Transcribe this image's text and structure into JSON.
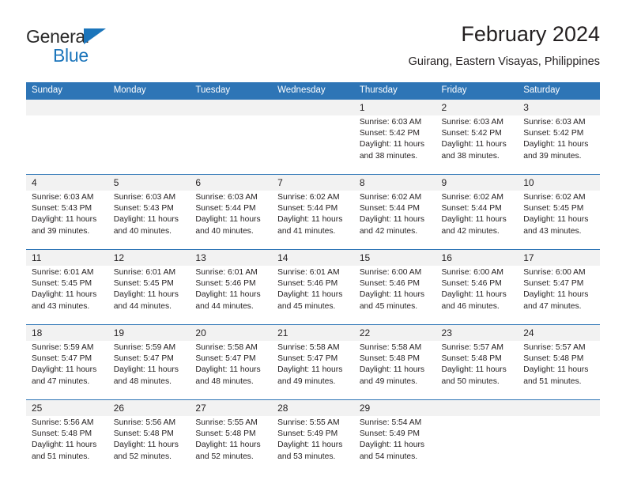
{
  "brand": {
    "name_part1": "General",
    "name_part2": "Blue",
    "accent_color": "#1b75bb"
  },
  "header": {
    "title": "February 2024",
    "subtitle": "Guirang, Eastern Visayas, Philippines"
  },
  "theme": {
    "header_blue": "#2e75b6",
    "daynum_background": "#f2f2f2",
    "text_color": "#231f20"
  },
  "calendar": {
    "weekday_headers": [
      "Sunday",
      "Monday",
      "Tuesday",
      "Wednesday",
      "Thursday",
      "Friday",
      "Saturday"
    ],
    "weeks": [
      [
        {
          "day": "",
          "sunrise": "",
          "sunset": "",
          "daylight": ""
        },
        {
          "day": "",
          "sunrise": "",
          "sunset": "",
          "daylight": ""
        },
        {
          "day": "",
          "sunrise": "",
          "sunset": "",
          "daylight": ""
        },
        {
          "day": "",
          "sunrise": "",
          "sunset": "",
          "daylight": ""
        },
        {
          "day": "1",
          "sunrise": "Sunrise: 6:03 AM",
          "sunset": "Sunset: 5:42 PM",
          "daylight": "Daylight: 11 hours and 38 minutes."
        },
        {
          "day": "2",
          "sunrise": "Sunrise: 6:03 AM",
          "sunset": "Sunset: 5:42 PM",
          "daylight": "Daylight: 11 hours and 38 minutes."
        },
        {
          "day": "3",
          "sunrise": "Sunrise: 6:03 AM",
          "sunset": "Sunset: 5:42 PM",
          "daylight": "Daylight: 11 hours and 39 minutes."
        }
      ],
      [
        {
          "day": "4",
          "sunrise": "Sunrise: 6:03 AM",
          "sunset": "Sunset: 5:43 PM",
          "daylight": "Daylight: 11 hours and 39 minutes."
        },
        {
          "day": "5",
          "sunrise": "Sunrise: 6:03 AM",
          "sunset": "Sunset: 5:43 PM",
          "daylight": "Daylight: 11 hours and 40 minutes."
        },
        {
          "day": "6",
          "sunrise": "Sunrise: 6:03 AM",
          "sunset": "Sunset: 5:44 PM",
          "daylight": "Daylight: 11 hours and 40 minutes."
        },
        {
          "day": "7",
          "sunrise": "Sunrise: 6:02 AM",
          "sunset": "Sunset: 5:44 PM",
          "daylight": "Daylight: 11 hours and 41 minutes."
        },
        {
          "day": "8",
          "sunrise": "Sunrise: 6:02 AM",
          "sunset": "Sunset: 5:44 PM",
          "daylight": "Daylight: 11 hours and 42 minutes."
        },
        {
          "day": "9",
          "sunrise": "Sunrise: 6:02 AM",
          "sunset": "Sunset: 5:44 PM",
          "daylight": "Daylight: 11 hours and 42 minutes."
        },
        {
          "day": "10",
          "sunrise": "Sunrise: 6:02 AM",
          "sunset": "Sunset: 5:45 PM",
          "daylight": "Daylight: 11 hours and 43 minutes."
        }
      ],
      [
        {
          "day": "11",
          "sunrise": "Sunrise: 6:01 AM",
          "sunset": "Sunset: 5:45 PM",
          "daylight": "Daylight: 11 hours and 43 minutes."
        },
        {
          "day": "12",
          "sunrise": "Sunrise: 6:01 AM",
          "sunset": "Sunset: 5:45 PM",
          "daylight": "Daylight: 11 hours and 44 minutes."
        },
        {
          "day": "13",
          "sunrise": "Sunrise: 6:01 AM",
          "sunset": "Sunset: 5:46 PM",
          "daylight": "Daylight: 11 hours and 44 minutes."
        },
        {
          "day": "14",
          "sunrise": "Sunrise: 6:01 AM",
          "sunset": "Sunset: 5:46 PM",
          "daylight": "Daylight: 11 hours and 45 minutes."
        },
        {
          "day": "15",
          "sunrise": "Sunrise: 6:00 AM",
          "sunset": "Sunset: 5:46 PM",
          "daylight": "Daylight: 11 hours and 45 minutes."
        },
        {
          "day": "16",
          "sunrise": "Sunrise: 6:00 AM",
          "sunset": "Sunset: 5:46 PM",
          "daylight": "Daylight: 11 hours and 46 minutes."
        },
        {
          "day": "17",
          "sunrise": "Sunrise: 6:00 AM",
          "sunset": "Sunset: 5:47 PM",
          "daylight": "Daylight: 11 hours and 47 minutes."
        }
      ],
      [
        {
          "day": "18",
          "sunrise": "Sunrise: 5:59 AM",
          "sunset": "Sunset: 5:47 PM",
          "daylight": "Daylight: 11 hours and 47 minutes."
        },
        {
          "day": "19",
          "sunrise": "Sunrise: 5:59 AM",
          "sunset": "Sunset: 5:47 PM",
          "daylight": "Daylight: 11 hours and 48 minutes."
        },
        {
          "day": "20",
          "sunrise": "Sunrise: 5:58 AM",
          "sunset": "Sunset: 5:47 PM",
          "daylight": "Daylight: 11 hours and 48 minutes."
        },
        {
          "day": "21",
          "sunrise": "Sunrise: 5:58 AM",
          "sunset": "Sunset: 5:47 PM",
          "daylight": "Daylight: 11 hours and 49 minutes."
        },
        {
          "day": "22",
          "sunrise": "Sunrise: 5:58 AM",
          "sunset": "Sunset: 5:48 PM",
          "daylight": "Daylight: 11 hours and 49 minutes."
        },
        {
          "day": "23",
          "sunrise": "Sunrise: 5:57 AM",
          "sunset": "Sunset: 5:48 PM",
          "daylight": "Daylight: 11 hours and 50 minutes."
        },
        {
          "day": "24",
          "sunrise": "Sunrise: 5:57 AM",
          "sunset": "Sunset: 5:48 PM",
          "daylight": "Daylight: 11 hours and 51 minutes."
        }
      ],
      [
        {
          "day": "25",
          "sunrise": "Sunrise: 5:56 AM",
          "sunset": "Sunset: 5:48 PM",
          "daylight": "Daylight: 11 hours and 51 minutes."
        },
        {
          "day": "26",
          "sunrise": "Sunrise: 5:56 AM",
          "sunset": "Sunset: 5:48 PM",
          "daylight": "Daylight: 11 hours and 52 minutes."
        },
        {
          "day": "27",
          "sunrise": "Sunrise: 5:55 AM",
          "sunset": "Sunset: 5:48 PM",
          "daylight": "Daylight: 11 hours and 52 minutes."
        },
        {
          "day": "28",
          "sunrise": "Sunrise: 5:55 AM",
          "sunset": "Sunset: 5:49 PM",
          "daylight": "Daylight: 11 hours and 53 minutes."
        },
        {
          "day": "29",
          "sunrise": "Sunrise: 5:54 AM",
          "sunset": "Sunset: 5:49 PM",
          "daylight": "Daylight: 11 hours and 54 minutes."
        },
        {
          "day": "",
          "sunrise": "",
          "sunset": "",
          "daylight": ""
        },
        {
          "day": "",
          "sunrise": "",
          "sunset": "",
          "daylight": ""
        }
      ]
    ]
  }
}
